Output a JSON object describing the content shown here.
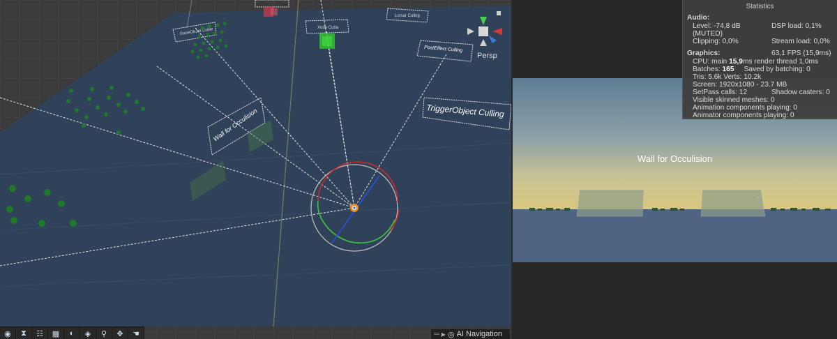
{
  "scene": {
    "labels": {
      "wall_for_occulision": "Wall for Occulision",
      "trigger_object_culling": "TriggerObject Culling",
      "post_effect_culling": "PostEffect Culling",
      "persp": "Persp",
      "ai_navigation": "AI Navigation"
    },
    "colors": {
      "ground": "#2f4158",
      "grid": "#4a4a4a",
      "gizmo_red": "#cc2a2a",
      "gizmo_green": "#3dbb3d",
      "gizmo_blue": "#2a4fd1"
    }
  },
  "game": {
    "wall_caption": "Wall for Occulision"
  },
  "statistics": {
    "title": "Statistics",
    "audio": {
      "title": "Audio:",
      "level": "Level: -74,8 dB (MUTED)",
      "dsp_load": "DSP load: 0,1%",
      "clipping": "Clipping: 0,0%",
      "stream_load": "Stream load: 0,0%"
    },
    "graphics": {
      "title": "Graphics:",
      "fps": "63,1 FPS (15,9ms)",
      "cpu_prefix": "CPU: main ",
      "cpu_main": "15,9",
      "cpu_suffix": "ms  render thread 1,0ms",
      "batches_prefix": "Batches: ",
      "batches": "165",
      "saved_by_batching": "Saved by batching: 0",
      "tris": "Tris: 5.6k   Verts: 10.2k",
      "screen": "Screen: 1920x1080 - 23.7 MB",
      "setpass": "SetPass calls: 12",
      "shadow_casters": "Shadow casters: 0",
      "visible_skinned": "Visible skinned meshes: 0",
      "animation_components": "Animation components playing: 0",
      "animator_components": "Animator components playing: 0"
    }
  },
  "toolbar": {
    "tools": [
      "view-tool",
      "hourglass-tool",
      "hierarchy-tool",
      "grid-tool",
      "moon-tool",
      "layers-tool",
      "search-tool",
      "move-tool",
      "hand-tool"
    ]
  }
}
